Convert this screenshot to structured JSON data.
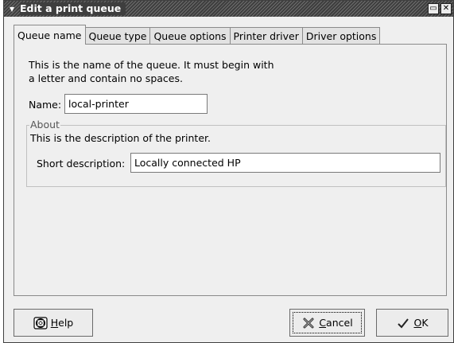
{
  "window": {
    "title": "Edit a print queue",
    "menu_glyph": "▾",
    "shade_glyph": "▭",
    "close_glyph": "✕"
  },
  "tabs": [
    {
      "label": "Queue name",
      "active": true
    },
    {
      "label": "Queue type"
    },
    {
      "label": "Queue options"
    },
    {
      "label": "Printer driver"
    },
    {
      "label": "Driver options"
    }
  ],
  "queue_name": {
    "description_line1": "This is the name of the queue.  It must begin with",
    "description_line2": "a letter and contain no spaces.",
    "name_label": "Name:",
    "name_value": "local-printer"
  },
  "about": {
    "legend": "About",
    "description": "This is the description of the printer.",
    "short_label": "Short description:",
    "short_value": "Locally connected HP"
  },
  "buttons": {
    "help_mnemonic": "H",
    "help_rest": "elp",
    "cancel_mnemonic": "C",
    "cancel_rest": "ancel",
    "ok_mnemonic": "O",
    "ok_rest": "K"
  },
  "icons": {
    "help": "help-lifebuoy-icon",
    "cancel": "cancel-x-icon",
    "ok": "check-icon"
  }
}
